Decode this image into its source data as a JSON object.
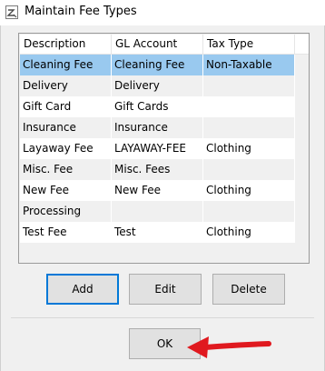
{
  "window": {
    "title": "Maintain Fee Types"
  },
  "grid": {
    "columns": [
      "Description",
      "GL Account",
      "Tax Type"
    ],
    "rows": [
      {
        "description": "Cleaning Fee",
        "gl_account": "Cleaning Fee",
        "tax_type": "Non-Taxable",
        "selected": true
      },
      {
        "description": "Delivery",
        "gl_account": "Delivery",
        "tax_type": ""
      },
      {
        "description": "Gift Card",
        "gl_account": "Gift Cards",
        "tax_type": ""
      },
      {
        "description": "Insurance",
        "gl_account": "Insurance",
        "tax_type": ""
      },
      {
        "description": "Layaway Fee",
        "gl_account": "LAYAWAY-FEE",
        "tax_type": "Clothing"
      },
      {
        "description": "Misc. Fee",
        "gl_account": "Misc. Fees",
        "tax_type": ""
      },
      {
        "description": "New Fee",
        "gl_account": "New Fee",
        "tax_type": "Clothing"
      },
      {
        "description": "Processing",
        "gl_account": "",
        "tax_type": ""
      },
      {
        "description": "Test Fee",
        "gl_account": "Test",
        "tax_type": "Clothing"
      }
    ]
  },
  "buttons": {
    "add": "Add",
    "edit": "Edit",
    "delete": "Delete",
    "ok": "OK"
  },
  "colors": {
    "selection": "#99c9ef",
    "default_button_border": "#0078d7",
    "arrow": "#e0191f"
  },
  "icons": {
    "app": "app-icon",
    "annotation": "red-arrow-icon"
  }
}
